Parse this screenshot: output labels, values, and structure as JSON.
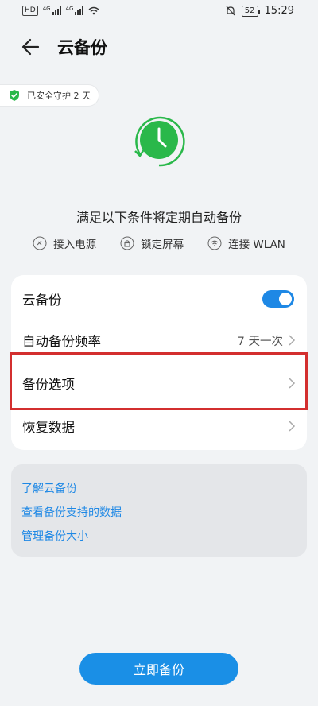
{
  "status_bar": {
    "left": {
      "hd": "HD",
      "sim1": "4G",
      "sim2": "4G"
    },
    "battery": "52",
    "time": "15:29"
  },
  "header": {
    "title": "云备份"
  },
  "protection_badge": {
    "text": "已安全守护 2 天"
  },
  "description": "满足以下条件将定期自动备份",
  "conditions": [
    {
      "label": "接入电源",
      "icon": "power-plug-icon"
    },
    {
      "label": "锁定屏幕",
      "icon": "lock-icon"
    },
    {
      "label": "连接 WLAN",
      "icon": "wifi-icon"
    }
  ],
  "settings": {
    "cloud_backup": {
      "label": "云备份",
      "toggle_on": true
    },
    "frequency": {
      "label": "自动备份频率",
      "value": "7 天一次"
    },
    "options": {
      "label": "备份选项"
    },
    "restore": {
      "label": "恢复数据"
    }
  },
  "links": [
    "了解云备份",
    "查看备份支持的数据",
    "管理备份大小"
  ],
  "action_button": "立即备份",
  "colors": {
    "accent": "#1e88e5",
    "green": "#2ab84a",
    "highlight": "#d32f2f"
  }
}
